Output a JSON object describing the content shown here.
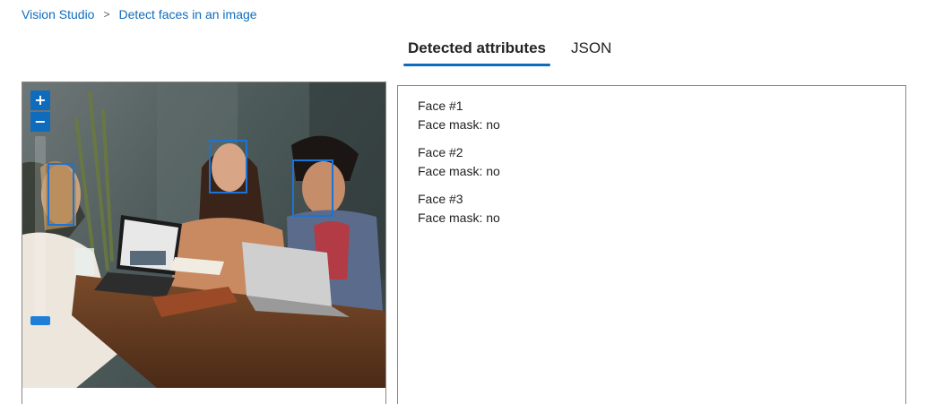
{
  "breadcrumb": {
    "root": "Vision Studio",
    "separator": ">",
    "current": "Detect faces in an image"
  },
  "tabs": [
    {
      "label": "Detected attributes",
      "active": true
    },
    {
      "label": "JSON",
      "active": false
    }
  ],
  "image_viewer": {
    "zoom_in_label": "+",
    "zoom_out_label": "−",
    "zoom_level_fraction": 0.0
  },
  "faces": [
    {
      "title": "Face #1",
      "attribute": "Face mask: no"
    },
    {
      "title": "Face #2",
      "attribute": "Face mask: no"
    },
    {
      "title": "Face #3",
      "attribute": "Face mask: no"
    }
  ],
  "colors": {
    "accent": "#0f6cbd",
    "face_box": "#1a73d9"
  }
}
